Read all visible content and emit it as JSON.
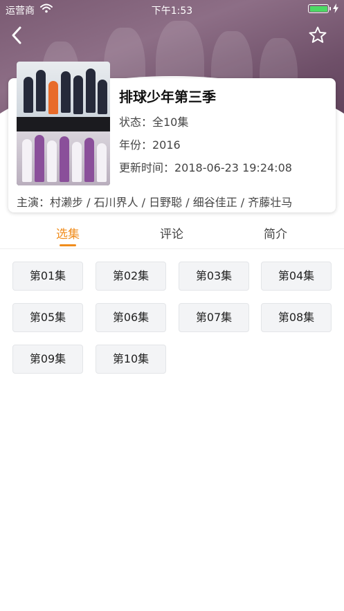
{
  "status_bar": {
    "carrier": "运营商",
    "time": "下午1:53",
    "battery_color": "#4cd964"
  },
  "header": {
    "back_icon": "chevron-left-icon",
    "favorite_icon": "star-outline-icon"
  },
  "anime": {
    "title": "排球少年第三季",
    "status": "状态：全10集",
    "year": "年份：2016",
    "updated": "更新时间：2018-06-23 19:24:08",
    "cast": "主演：村濑步 / 石川界人 / 日野聪 / 细谷佳正 / 齐藤壮马"
  },
  "tabs": [
    {
      "label": "选集",
      "active": true
    },
    {
      "label": "评论",
      "active": false
    },
    {
      "label": "简介",
      "active": false
    }
  ],
  "accent_color": "#f08c1c",
  "episodes": [
    "第01集",
    "第02集",
    "第03集",
    "第04集",
    "第05集",
    "第06集",
    "第07集",
    "第08集",
    "第09集",
    "第10集"
  ]
}
